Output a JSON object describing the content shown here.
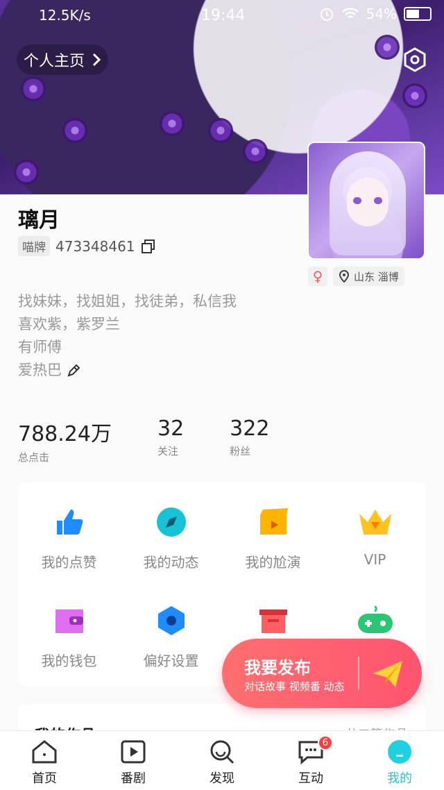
{
  "status_bar": {
    "speed": "12.5K/s",
    "time": "19:44",
    "battery": "54%"
  },
  "header": {
    "homepage_label": "个人主页",
    "settings_icon": "hex-settings-icon"
  },
  "profile": {
    "nickname": "璃月",
    "id_label": "喵牌",
    "id_value": "473348461",
    "gender_symbol": "♀",
    "location": "山东 淄博",
    "bio": [
      "找妹妹，找姐姐，找徒弟，私信我",
      "喜欢紫，紫罗兰",
      "有师傅",
      "爱热巴"
    ]
  },
  "stats": [
    {
      "value": "788.24万",
      "label": "总点击"
    },
    {
      "value": "32",
      "label": "关注"
    },
    {
      "value": "322",
      "label": "粉丝"
    }
  ],
  "menu": {
    "row1": [
      "我的点赞",
      "我的动态",
      "我的尬演",
      "VIP"
    ],
    "row2": [
      "我的钱包",
      "偏好设置"
    ]
  },
  "works": {
    "title": "我的作品",
    "more": "共二篇作品"
  },
  "publish": {
    "title": "我要发布",
    "subtitle": "对话故事 视频番 动态"
  },
  "tabbar": {
    "items": [
      "首页",
      "番剧",
      "发现",
      "互动",
      "我的"
    ],
    "badge": "6"
  },
  "colors": {
    "accent": "#1cc7d6",
    "publish": "#ff5f6f",
    "badge": "#ff3b3b"
  }
}
